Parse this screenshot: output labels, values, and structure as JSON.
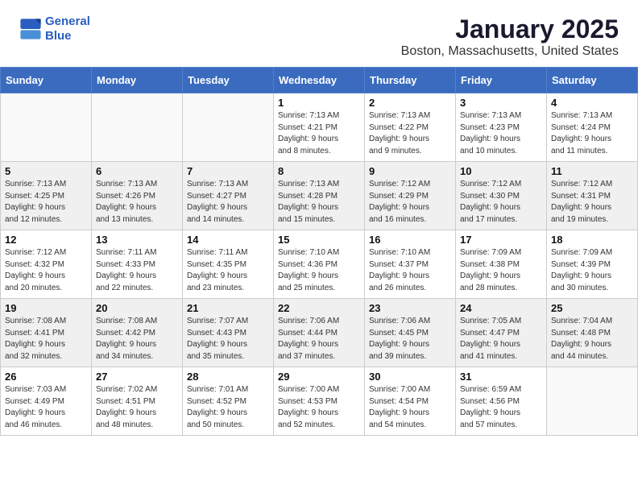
{
  "header": {
    "logo_line1": "General",
    "logo_line2": "Blue",
    "month": "January 2025",
    "location": "Boston, Massachusetts, United States"
  },
  "weekdays": [
    "Sunday",
    "Monday",
    "Tuesday",
    "Wednesday",
    "Thursday",
    "Friday",
    "Saturday"
  ],
  "weeks": [
    [
      {
        "day": "",
        "info": ""
      },
      {
        "day": "",
        "info": ""
      },
      {
        "day": "",
        "info": ""
      },
      {
        "day": "1",
        "info": "Sunrise: 7:13 AM\nSunset: 4:21 PM\nDaylight: 9 hours\nand 8 minutes."
      },
      {
        "day": "2",
        "info": "Sunrise: 7:13 AM\nSunset: 4:22 PM\nDaylight: 9 hours\nand 9 minutes."
      },
      {
        "day": "3",
        "info": "Sunrise: 7:13 AM\nSunset: 4:23 PM\nDaylight: 9 hours\nand 10 minutes."
      },
      {
        "day": "4",
        "info": "Sunrise: 7:13 AM\nSunset: 4:24 PM\nDaylight: 9 hours\nand 11 minutes."
      }
    ],
    [
      {
        "day": "5",
        "info": "Sunrise: 7:13 AM\nSunset: 4:25 PM\nDaylight: 9 hours\nand 12 minutes."
      },
      {
        "day": "6",
        "info": "Sunrise: 7:13 AM\nSunset: 4:26 PM\nDaylight: 9 hours\nand 13 minutes."
      },
      {
        "day": "7",
        "info": "Sunrise: 7:13 AM\nSunset: 4:27 PM\nDaylight: 9 hours\nand 14 minutes."
      },
      {
        "day": "8",
        "info": "Sunrise: 7:13 AM\nSunset: 4:28 PM\nDaylight: 9 hours\nand 15 minutes."
      },
      {
        "day": "9",
        "info": "Sunrise: 7:12 AM\nSunset: 4:29 PM\nDaylight: 9 hours\nand 16 minutes."
      },
      {
        "day": "10",
        "info": "Sunrise: 7:12 AM\nSunset: 4:30 PM\nDaylight: 9 hours\nand 17 minutes."
      },
      {
        "day": "11",
        "info": "Sunrise: 7:12 AM\nSunset: 4:31 PM\nDaylight: 9 hours\nand 19 minutes."
      }
    ],
    [
      {
        "day": "12",
        "info": "Sunrise: 7:12 AM\nSunset: 4:32 PM\nDaylight: 9 hours\nand 20 minutes."
      },
      {
        "day": "13",
        "info": "Sunrise: 7:11 AM\nSunset: 4:33 PM\nDaylight: 9 hours\nand 22 minutes."
      },
      {
        "day": "14",
        "info": "Sunrise: 7:11 AM\nSunset: 4:35 PM\nDaylight: 9 hours\nand 23 minutes."
      },
      {
        "day": "15",
        "info": "Sunrise: 7:10 AM\nSunset: 4:36 PM\nDaylight: 9 hours\nand 25 minutes."
      },
      {
        "day": "16",
        "info": "Sunrise: 7:10 AM\nSunset: 4:37 PM\nDaylight: 9 hours\nand 26 minutes."
      },
      {
        "day": "17",
        "info": "Sunrise: 7:09 AM\nSunset: 4:38 PM\nDaylight: 9 hours\nand 28 minutes."
      },
      {
        "day": "18",
        "info": "Sunrise: 7:09 AM\nSunset: 4:39 PM\nDaylight: 9 hours\nand 30 minutes."
      }
    ],
    [
      {
        "day": "19",
        "info": "Sunrise: 7:08 AM\nSunset: 4:41 PM\nDaylight: 9 hours\nand 32 minutes."
      },
      {
        "day": "20",
        "info": "Sunrise: 7:08 AM\nSunset: 4:42 PM\nDaylight: 9 hours\nand 34 minutes."
      },
      {
        "day": "21",
        "info": "Sunrise: 7:07 AM\nSunset: 4:43 PM\nDaylight: 9 hours\nand 35 minutes."
      },
      {
        "day": "22",
        "info": "Sunrise: 7:06 AM\nSunset: 4:44 PM\nDaylight: 9 hours\nand 37 minutes."
      },
      {
        "day": "23",
        "info": "Sunrise: 7:06 AM\nSunset: 4:45 PM\nDaylight: 9 hours\nand 39 minutes."
      },
      {
        "day": "24",
        "info": "Sunrise: 7:05 AM\nSunset: 4:47 PM\nDaylight: 9 hours\nand 41 minutes."
      },
      {
        "day": "25",
        "info": "Sunrise: 7:04 AM\nSunset: 4:48 PM\nDaylight: 9 hours\nand 44 minutes."
      }
    ],
    [
      {
        "day": "26",
        "info": "Sunrise: 7:03 AM\nSunset: 4:49 PM\nDaylight: 9 hours\nand 46 minutes."
      },
      {
        "day": "27",
        "info": "Sunrise: 7:02 AM\nSunset: 4:51 PM\nDaylight: 9 hours\nand 48 minutes."
      },
      {
        "day": "28",
        "info": "Sunrise: 7:01 AM\nSunset: 4:52 PM\nDaylight: 9 hours\nand 50 minutes."
      },
      {
        "day": "29",
        "info": "Sunrise: 7:00 AM\nSunset: 4:53 PM\nDaylight: 9 hours\nand 52 minutes."
      },
      {
        "day": "30",
        "info": "Sunrise: 7:00 AM\nSunset: 4:54 PM\nDaylight: 9 hours\nand 54 minutes."
      },
      {
        "day": "31",
        "info": "Sunrise: 6:59 AM\nSunset: 4:56 PM\nDaylight: 9 hours\nand 57 minutes."
      },
      {
        "day": "",
        "info": ""
      }
    ]
  ]
}
